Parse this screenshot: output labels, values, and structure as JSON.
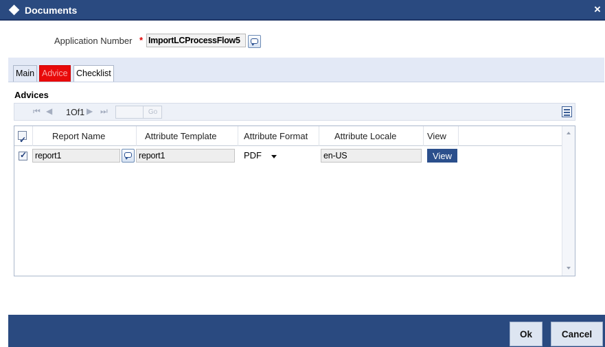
{
  "window": {
    "title": "Documents",
    "close_label": "×"
  },
  "header": {
    "application_number_label": "Application Number",
    "required_mark": "*",
    "application_number_value": "ImportLCProcessFlow5"
  },
  "tabs": [
    {
      "label": "Main",
      "active": false
    },
    {
      "label": "Advice",
      "active": true
    },
    {
      "label": "Checklist",
      "active": false
    }
  ],
  "advices": {
    "section_title": "Advices",
    "pager": {
      "first": "⏮",
      "prev": "◀",
      "page_text": "1Of1",
      "next": "▶",
      "last": "⏭",
      "go_label": "Go"
    },
    "columns": [
      "Report Name",
      "Attribute Template",
      "Attribute Format",
      "Attribute Locale",
      "View"
    ],
    "rows": [
      {
        "checked": true,
        "report_name": "report1",
        "attribute_template": "report1",
        "attribute_format": "PDF",
        "attribute_locale": "en-US",
        "view_label": "View"
      }
    ]
  },
  "footer": {
    "ok_label": "Ok",
    "cancel_label": "Cancel"
  },
  "colors": {
    "title_bar": "#2a4a80",
    "active_tab": "#e80a0a",
    "footer": "#2a4a80",
    "view_button": "#2b4f8c"
  }
}
